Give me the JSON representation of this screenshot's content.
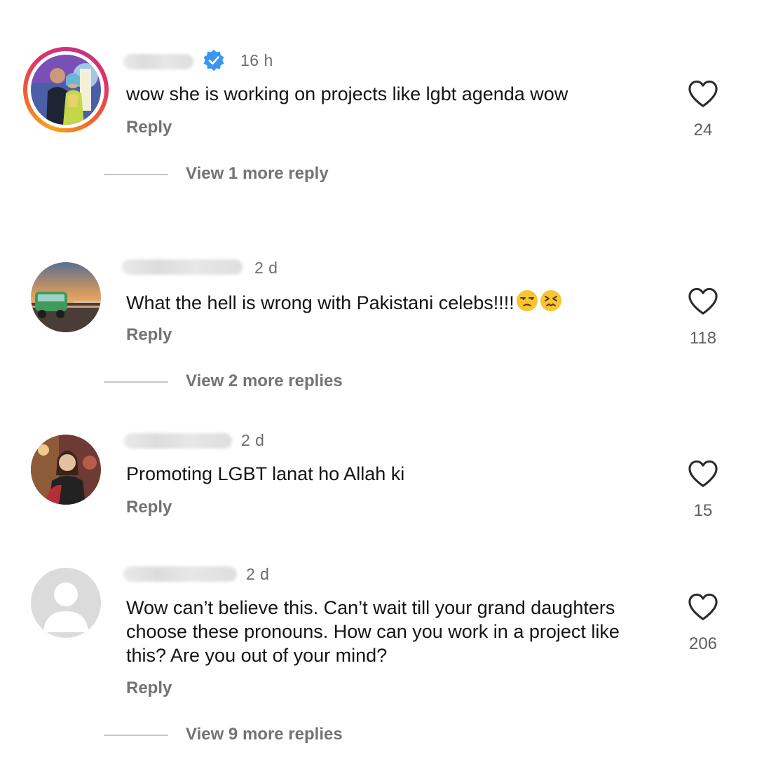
{
  "comments": [
    {
      "time": "16 h",
      "verified": true,
      "text": "wow she is working on projects like lgbt agenda wow",
      "reply_label": "Reply",
      "likes": "24",
      "view_replies": "View 1 more reply"
    },
    {
      "time": "2 d",
      "verified": false,
      "text": "What the hell is wrong with Pakistani celebs!!!!",
      "emojis": [
        "unamused-face",
        "confounded-face"
      ],
      "reply_label": "Reply",
      "likes": "118",
      "view_replies": "View 2 more replies"
    },
    {
      "time": "2 d",
      "verified": false,
      "text": "Promoting LGBT lanat ho Allah ki",
      "reply_label": "Reply",
      "likes": "15"
    },
    {
      "time": "2 d",
      "verified": false,
      "text": "Wow can’t believe this. Can’t wait till your grand daughters choose these pronouns. How can you work in a project like this? Are you out of your mind?",
      "reply_label": "Reply",
      "likes": "206",
      "view_replies": "View 9 more replies"
    }
  ],
  "icons": {
    "like": "heart-outline-icon",
    "verified": "verified-badge-icon",
    "default_avatar": "default-avatar-icon"
  },
  "colors": {
    "verified_blue": "#3897f0",
    "story_ring": [
      "#f7a21b",
      "#e1306c",
      "#c13584"
    ],
    "secondary_text": "#737373"
  }
}
